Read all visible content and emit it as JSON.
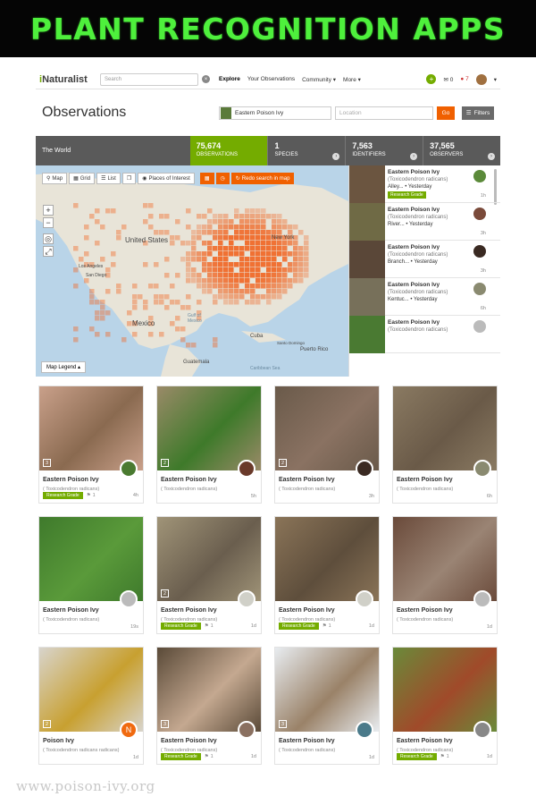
{
  "banner": {
    "title": "PLANT RECOGNITION APPS"
  },
  "header": {
    "logo_prefix": "i",
    "logo_rest": "Naturalist",
    "search_placeholder": "Search",
    "nav": [
      "Explore",
      "Your Observations",
      "Community ▾",
      "More ▾"
    ],
    "messages_count": "0",
    "notifications_count": "7"
  },
  "titlebar": {
    "title": "Observations",
    "species": "Eastern Poison Ivy",
    "location_placeholder": "Location",
    "go": "Go",
    "filters": "Filters"
  },
  "stats": {
    "place": "The World",
    "items": [
      {
        "num": "75,674",
        "label": "OBSERVATIONS"
      },
      {
        "num": "1",
        "label": "SPECIES"
      },
      {
        "num": "7,563",
        "label": "IDENTIFIERS"
      },
      {
        "num": "37,565",
        "label": "OBSERVERS"
      }
    ]
  },
  "map": {
    "tools": [
      "Map",
      "Grid",
      "List",
      "Places of Interest",
      "Redo search in map"
    ],
    "legend": "Map Legend ▴",
    "labels": [
      "United States",
      "New York",
      "Mexico",
      "Gulf of Mexico",
      "Cuba",
      "Puerto Rico",
      "Guatemala",
      "Los Angeles",
      "San Diego",
      "Caribbean Sea",
      "Santo Domingo"
    ]
  },
  "side_list": [
    {
      "name": "Eastern Poison Ivy",
      "sci": "(Toxicodendron radicans)",
      "meta": "Alley... • Yesterday",
      "rg": "Research Grade",
      "time": "1h",
      "thumb": "#6b5540",
      "avatar": "#5b8a3a"
    },
    {
      "name": "Eastern Poison Ivy",
      "sci": "(Toxicodendron radicans)",
      "meta": "River... • Yesterday",
      "rg": "",
      "time": "3h",
      "thumb": "#6f6a45",
      "avatar": "#7a4a3a"
    },
    {
      "name": "Eastern Poison Ivy",
      "sci": "(Toxicodendron radicans)",
      "meta": "Branch... • Yesterday",
      "rg": "",
      "time": "3h",
      "thumb": "#5a4738",
      "avatar": "#3a2a22"
    },
    {
      "name": "Eastern Poison Ivy",
      "sci": "(Toxicodendron radicans)",
      "meta": "Kentuc... • Yesterday",
      "rg": "",
      "time": "6h",
      "thumb": "#77705a",
      "avatar": "#8a8a70"
    },
    {
      "name": "Eastern Poison Ivy",
      "sci": "(Toxicodendron radicans)",
      "meta": "",
      "rg": "",
      "time": "",
      "thumb": "#4a7a32",
      "avatar": "#bbbbbb"
    }
  ],
  "cards": [
    {
      "name": "Eastern Poison Ivy",
      "sci": "( Toxicodendron radicans)",
      "rg": "Research Grade",
      "ids": "1",
      "time": "4h",
      "num": "3",
      "photo1": "#c9a08a",
      "photo2": "#8a6a50",
      "avatar": "#4a7a30"
    },
    {
      "name": "Eastern Poison Ivy",
      "sci": "( Toxicodendron radicans)",
      "rg": "",
      "ids": "",
      "time": "5h",
      "num": "2",
      "photo1": "#9a8a68",
      "photo2": "#3e7a2a",
      "avatar": "#6a3a2a"
    },
    {
      "name": "Eastern Poison Ivy",
      "sci": "( Toxicodendron radicans)",
      "rg": "",
      "ids": "",
      "time": "3h",
      "num": "2",
      "photo1": "#6a5a4a",
      "photo2": "#8a7262",
      "avatar": "#3a2a22"
    },
    {
      "name": "Eastern Poison Ivy",
      "sci": "( Toxicodendron radicans)",
      "rg": "",
      "ids": "",
      "time": "6h",
      "num": "",
      "photo1": "#8a7a62",
      "photo2": "#6a5a48",
      "avatar": "#8a8a70"
    },
    {
      "name": "Eastern Poison Ivy",
      "sci": "( Toxicodendron radicans)",
      "rg": "",
      "ids": "",
      "time": "19s",
      "num": "",
      "photo1": "#3f7a2c",
      "photo2": "#5a9a3a",
      "avatar": "#bbbbbb"
    },
    {
      "name": "Eastern Poison Ivy",
      "sci": "( Toxicodendron radicans)",
      "rg": "Research Grade",
      "ids": "1",
      "time": "1d",
      "num": "2",
      "photo1": "#a09478",
      "photo2": "#6a5e4e",
      "avatar": "#d0d0c8"
    },
    {
      "name": "Eastern Poison Ivy",
      "sci": "( Toxicodendron radicans)",
      "rg": "Research Grade",
      "ids": "1",
      "time": "1d",
      "num": "",
      "photo1": "#8a7458",
      "photo2": "#5e4e3c",
      "avatar": "#d0d0c8"
    },
    {
      "name": "Eastern Poison Ivy",
      "sci": "( Toxicodendron radicans)",
      "rg": "",
      "ids": "",
      "time": "1d",
      "num": "",
      "photo1": "#6a4a3a",
      "photo2": "#9a8474",
      "avatar": "#bbbbbb"
    },
    {
      "name": "Poison Ivy",
      "sci": "( Toxicodendron radicans radicans)",
      "rg": "",
      "ids": "",
      "time": "1d",
      "num": "2",
      "photo1": "#d8d4cc",
      "photo2": "#c8a030",
      "avatar": "#f06a10",
      "avatar_letter": "N"
    },
    {
      "name": "Eastern Poison Ivy",
      "sci": "( Toxicodendron radicans)",
      "rg": "Research Grade",
      "ids": "1",
      "time": "1d",
      "num": "3",
      "photo1": "#5a4a38",
      "photo2": "#c4a890",
      "avatar": "#8a7060"
    },
    {
      "name": "Eastern Poison Ivy",
      "sci": "( Toxicodendron radicans)",
      "rg": "",
      "ids": "",
      "time": "1d",
      "num": "3",
      "photo1": "#e8ecf0",
      "photo2": "#9a8268",
      "avatar": "#4a7a8a"
    },
    {
      "name": "Eastern Poison Ivy",
      "sci": "( Toxicodendron radicans)",
      "rg": "Research Grade",
      "ids": "1",
      "time": "1d",
      "num": "",
      "photo1": "#6a8a3a",
      "photo2": "#a04a2a",
      "avatar": "#888888"
    }
  ],
  "watermark": "www.poison-ivy.org",
  "colors": {
    "brand_green": "#74ac00",
    "banner_green": "#4ef03c",
    "heat_orange": "#f06a2a"
  }
}
